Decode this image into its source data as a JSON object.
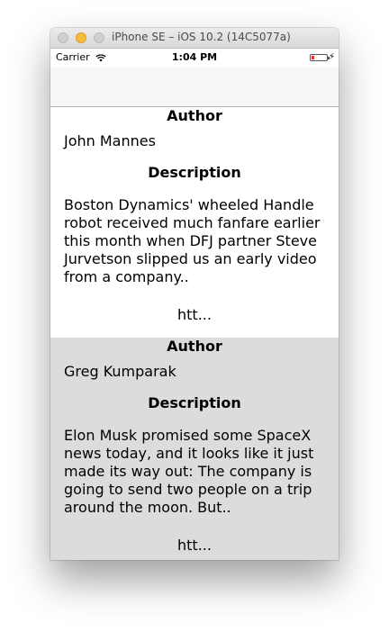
{
  "window": {
    "title": "iPhone SE – iOS 10.2 (14C5077a)"
  },
  "status_bar": {
    "carrier": "Carrier",
    "time": "1:04 PM"
  },
  "articles": [
    {
      "author_heading": "Author",
      "author": "John Mannes",
      "description_heading": "Description",
      "description": "Boston Dynamics' wheeled Handle robot received much fanfare earlier this month when DFJ partner Steve Jurvetson slipped us an early video from a company..",
      "link": "htt..."
    },
    {
      "author_heading": "Author",
      "author": "Greg Kumparak",
      "description_heading": "Description",
      "description": "Elon Musk promised some SpaceX news today, and it looks like it just made its way out: The company is going to send two people on a trip around the moon. But..",
      "link": "htt..."
    }
  ],
  "colors": {
    "alt_row": "#dcdcdc",
    "battery_low": "#e7341f",
    "minimize": "#f5bb3e"
  }
}
